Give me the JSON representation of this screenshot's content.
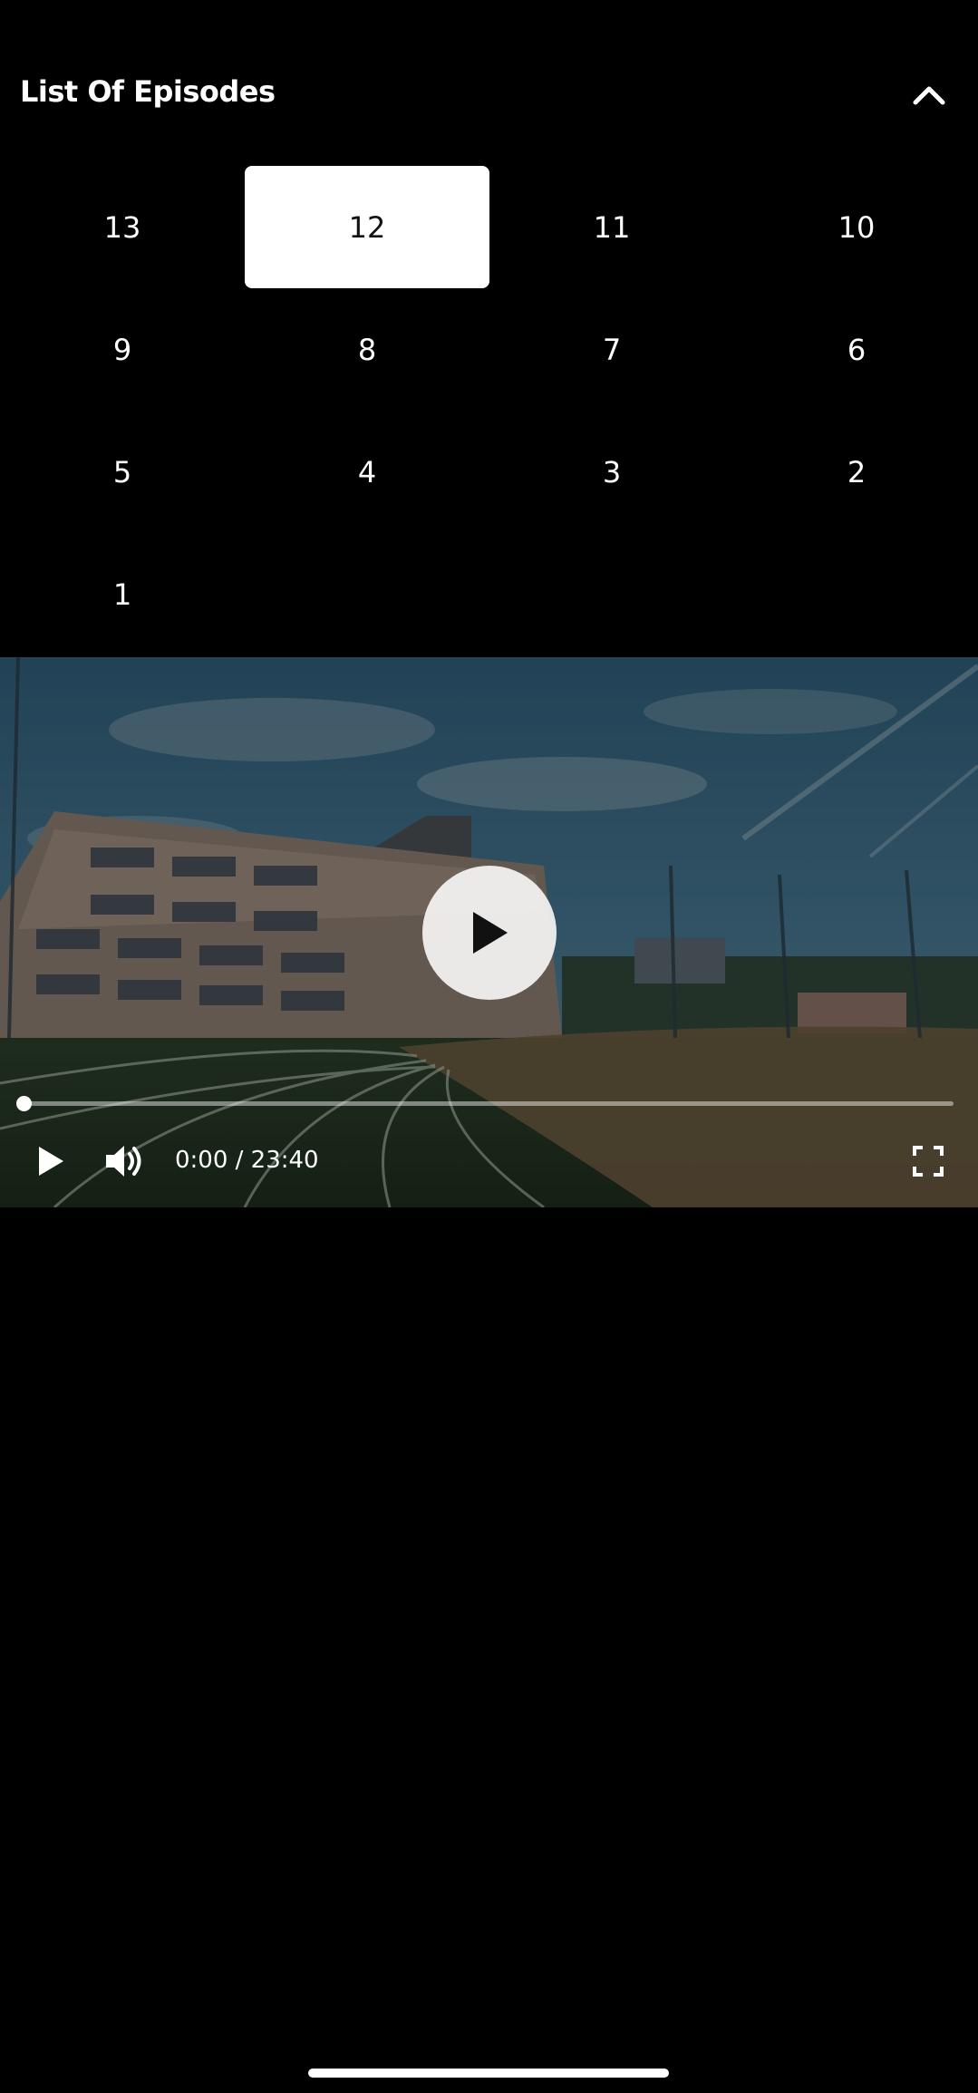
{
  "header": {
    "title": "List Of Episodes",
    "collapse_icon": "chevron-up-icon"
  },
  "episodes": {
    "items": [
      {
        "label": "13",
        "selected": false
      },
      {
        "label": "12",
        "selected": true
      },
      {
        "label": "11",
        "selected": false
      },
      {
        "label": "10",
        "selected": false
      },
      {
        "label": "9",
        "selected": false
      },
      {
        "label": "8",
        "selected": false
      },
      {
        "label": "7",
        "selected": false
      },
      {
        "label": "6",
        "selected": false
      },
      {
        "label": "5",
        "selected": false
      },
      {
        "label": "4",
        "selected": false
      },
      {
        "label": "3",
        "selected": false
      },
      {
        "label": "2",
        "selected": false
      },
      {
        "label": "1",
        "selected": false
      }
    ]
  },
  "player": {
    "current_time": "0:00",
    "separator": "/",
    "duration": "23:40",
    "time_text": "0:00 / 23:40",
    "progress": 0.0,
    "icons": {
      "big_play": "play-icon",
      "play": "play-icon",
      "volume": "volume-icon",
      "fullscreen": "fullscreen-icon"
    }
  },
  "colors": {
    "background": "#000000",
    "selected_episode_bg": "#ffffff",
    "selected_episode_text": "#111111",
    "text": "#ffffff"
  }
}
